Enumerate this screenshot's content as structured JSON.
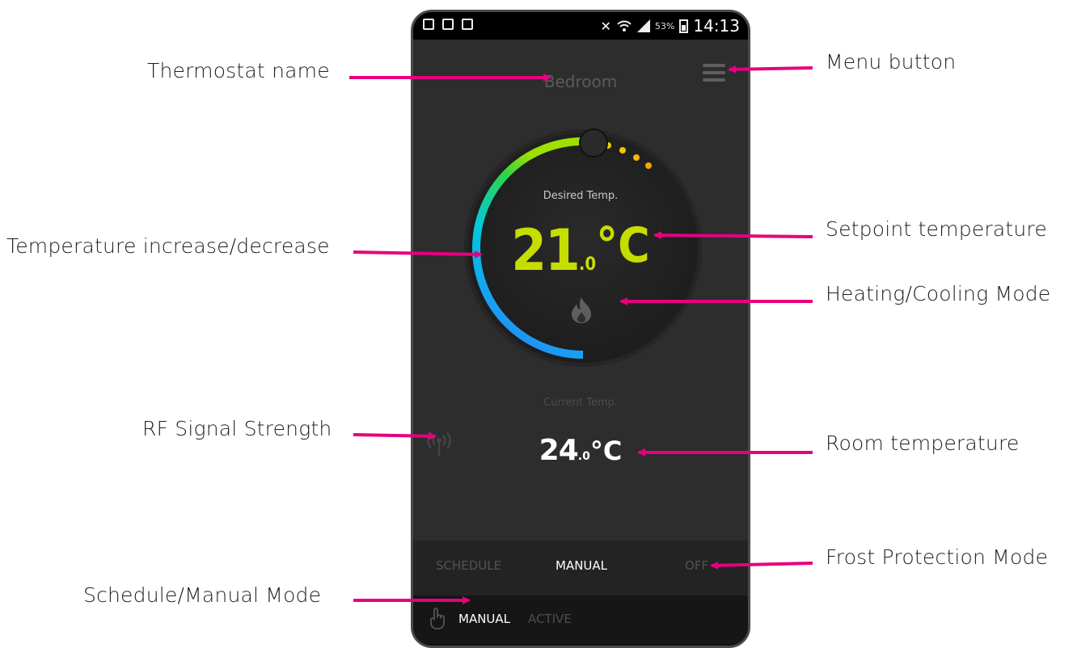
{
  "annotations": {
    "thermostat_name": "Thermostat name",
    "menu_button": "Menu button",
    "temp_increase_decrease": "Temperature increase/decrease",
    "setpoint_temperature": "Setpoint temperature",
    "heating_cooling_mode": "Heating/Cooling Mode",
    "rf_signal_strength": "RF Signal Strength",
    "room_temperature": "Room temperature",
    "frost_protection_mode": "Frost Protection Mode",
    "schedule_manual_mode": "Schedule/Manual Mode"
  },
  "status_bar": {
    "battery": "53%",
    "time": "14:13"
  },
  "thermostat": {
    "name": "Bedroom",
    "desired_label": "Desired Temp.",
    "setpoint_int": "21",
    "setpoint_dec": ".0",
    "setpoint_unit": "°C",
    "current_label": "Current Temp.",
    "room_int": "24",
    "room_dec": ".0",
    "room_unit": "°C"
  },
  "modes": {
    "schedule": "SCHEDULE",
    "manual": "MANUAL",
    "off": "OFF"
  },
  "active_status": {
    "mode": "MANUAL",
    "state": "ACTIVE"
  },
  "colors": {
    "accent_setpoint": "#c6dd00",
    "arrow": "#e6007e",
    "dial_gradient": [
      "#2e7bff",
      "#00c8e0",
      "#2fd44a",
      "#c8e000",
      "#ffc000"
    ]
  },
  "icons": [
    "menu-icon",
    "flame-icon",
    "rf-signal-icon",
    "hand-icon",
    "wifi-icon",
    "battery-icon"
  ]
}
